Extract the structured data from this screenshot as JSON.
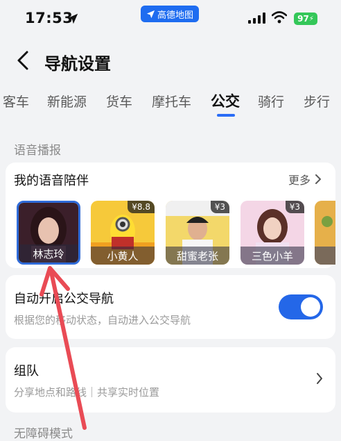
{
  "status_bar": {
    "time": "17:53",
    "app_name": "高德地图",
    "battery": "97"
  },
  "header": {
    "title": "导航设置"
  },
  "tabs": [
    {
      "label": "客车"
    },
    {
      "label": "新能源"
    },
    {
      "label": "货车"
    },
    {
      "label": "摩托车"
    },
    {
      "label": "公交",
      "active": true
    },
    {
      "label": "骑行"
    },
    {
      "label": "步行"
    }
  ],
  "section_voice": {
    "title": "语音播报"
  },
  "voice_card": {
    "title": "我的语音陪伴",
    "more": "更多",
    "voices": [
      {
        "name": "林志玲",
        "price": "",
        "selected": true
      },
      {
        "name": "小黄人",
        "price": "¥8.8"
      },
      {
        "name": "甜蜜老张",
        "price": "¥3"
      },
      {
        "name": "三色小羊",
        "price": "¥3"
      }
    ]
  },
  "auto_bus": {
    "title": "自动开启公交导航",
    "subtitle": "根据您的移动状态，自动进入公交导航",
    "enabled": true
  },
  "team": {
    "title": "组队",
    "subtitle": "分享地点和路线｜共享实时位置"
  },
  "next_section": {
    "title": "无障碍模式"
  },
  "colors": {
    "accent": "#2467e8",
    "annotation": "#e94b55"
  }
}
